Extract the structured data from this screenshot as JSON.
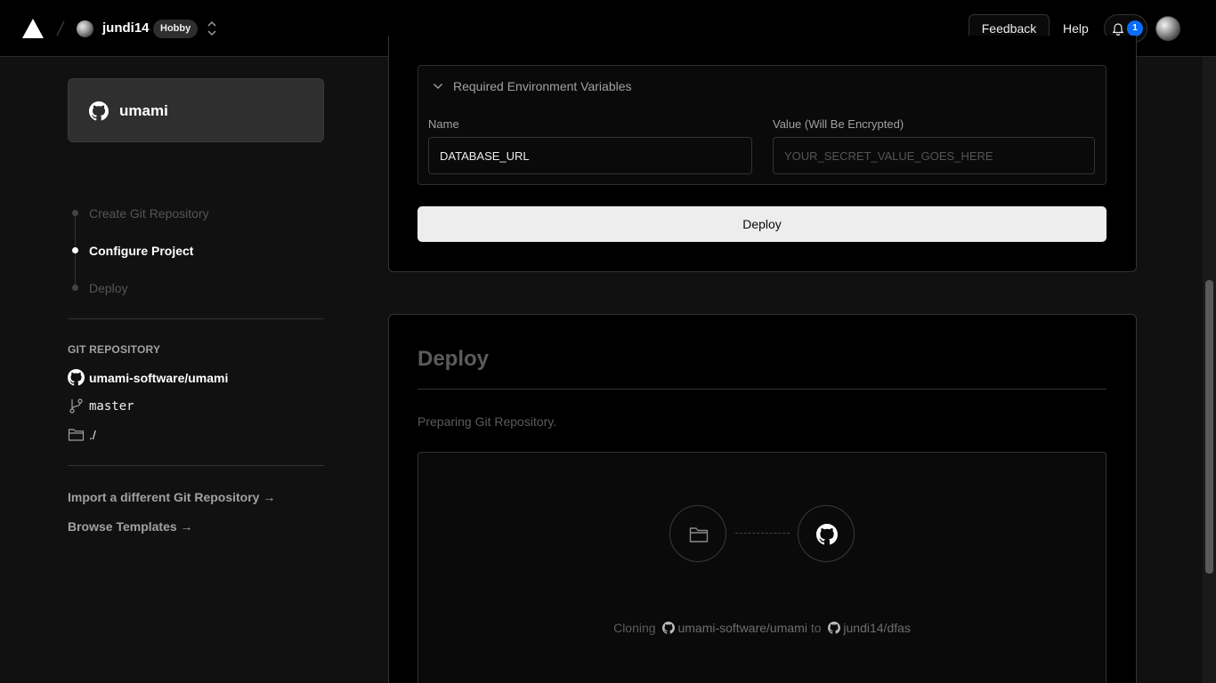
{
  "topbar": {
    "team_name": "jundi14",
    "plan_badge": "Hobby",
    "feedback_label": "Feedback",
    "help_label": "Help",
    "notification_count": "1"
  },
  "sidebar": {
    "repo_card_name": "umami",
    "steps": [
      {
        "label": "Create Git Repository",
        "state": "done"
      },
      {
        "label": "Configure Project",
        "state": "active"
      },
      {
        "label": "Deploy",
        "state": "pending"
      }
    ],
    "git_section_label": "GIT REPOSITORY",
    "git_repo": "umami-software/umami",
    "git_branch": "master",
    "git_dir": "./",
    "links": {
      "import_other": "Import a different Git Repository →",
      "browse_templates": "Browse Templates →"
    }
  },
  "configure": {
    "env_title": "Required Environment Variables",
    "name_label": "Name",
    "name_value": "DATABASE_URL",
    "value_label": "Value (Will Be Encrypted)",
    "value_placeholder": "YOUR_SECRET_VALUE_GOES_HERE",
    "deploy_button": "Deploy"
  },
  "deploy": {
    "title": "Deploy",
    "status": "Preparing Git Repository.",
    "clone_prefix": "Cloning",
    "clone_source": "umami-software/umami",
    "clone_to": "to",
    "clone_target": "jundi14/dfas"
  },
  "icons": {
    "logo": "triangle-logo-icon",
    "github": "github-icon",
    "branch": "git-branch-icon",
    "folder": "folder-icon",
    "bell": "bell-icon",
    "chevron": "chevron-down-icon",
    "switcher": "chevron-up-down-icon"
  },
  "colors": {
    "accent": "#0a6cff",
    "background": "#111111",
    "card": "#000000"
  }
}
